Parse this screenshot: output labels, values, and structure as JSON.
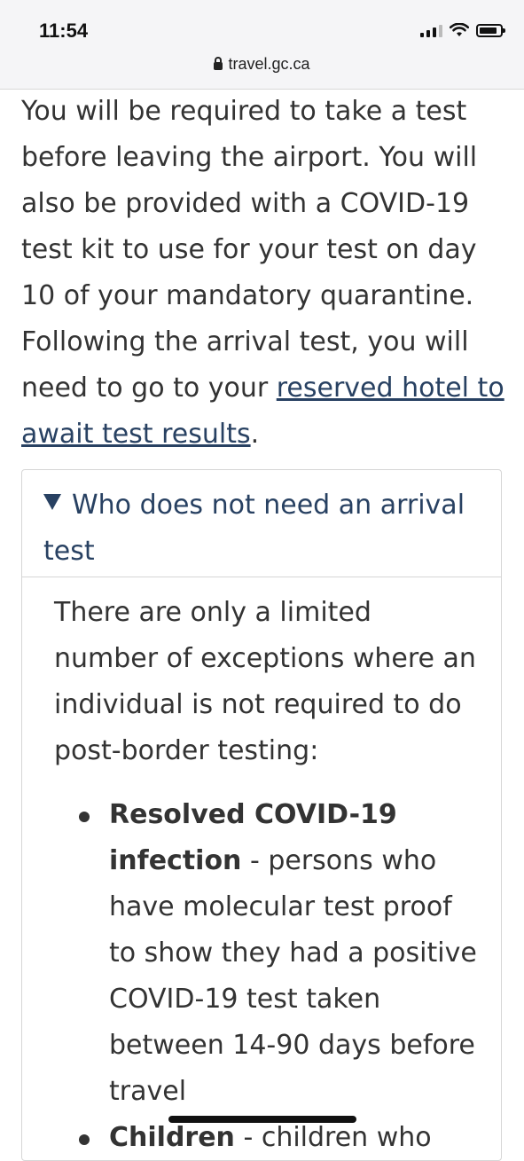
{
  "status_bar": {
    "time": "11:54"
  },
  "url_bar": {
    "domain": "travel.gc.ca"
  },
  "content": {
    "intro_text": "You will be required to take a test before leaving the airport. You will also be provided with a COVID-19 test kit to use for your test on day 10 of your mandatory quarantine. Following the arrival test, you will need to go to your ",
    "hotel_link": "reserved hotel to await test results",
    "intro_end": "."
  },
  "details": {
    "summary": "Who does not need an arrival test",
    "intro": "There are only a limited number of exceptions where an individual is not required to do post-border testing:",
    "items": [
      {
        "bold": "Resolved COVID-19 infection",
        "text": " - persons who have molecular test proof to show they had a positive COVID-19 test taken between 14-90 days before travel"
      },
      {
        "bold": "Children",
        "text": " - children who"
      }
    ]
  },
  "colors": {
    "link": "#284162",
    "text": "#333333"
  }
}
